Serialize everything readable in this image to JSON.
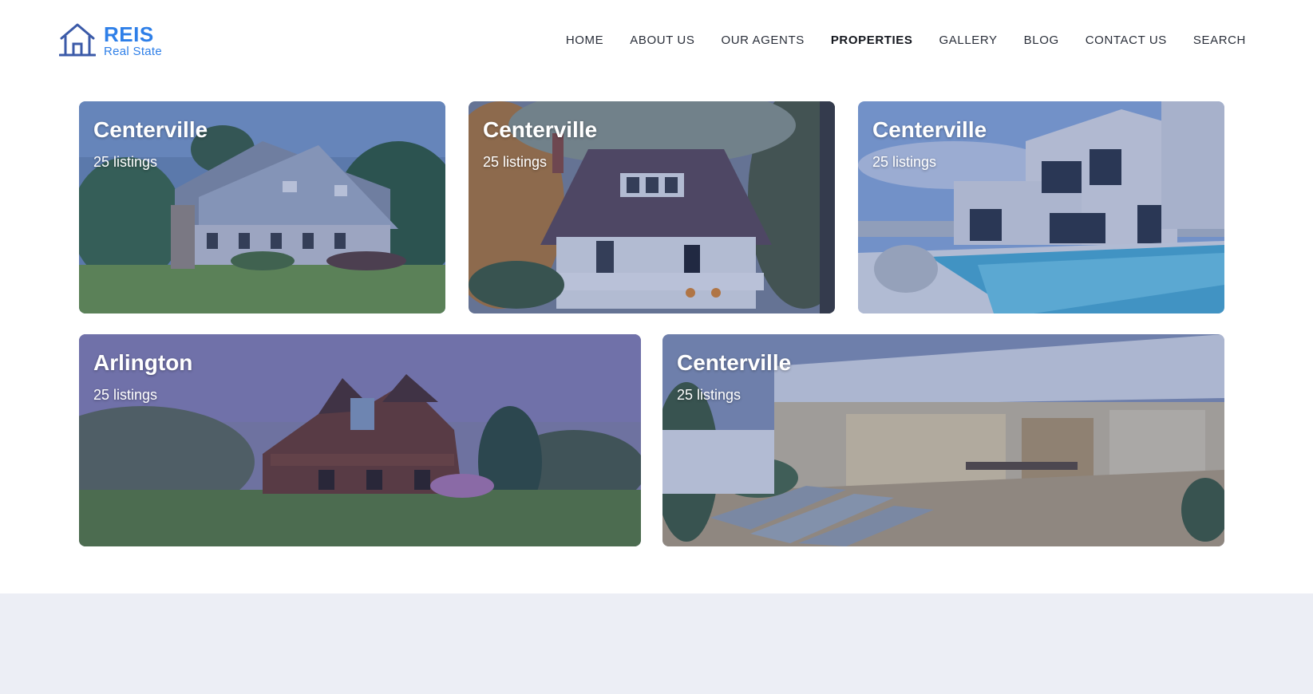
{
  "brand": {
    "title": "REIS",
    "subtitle": "Real State",
    "icon": "house-icon",
    "color": "#2e7fe8"
  },
  "nav": {
    "items": [
      {
        "label": "HOME"
      },
      {
        "label": "ABOUT US"
      },
      {
        "label": "OUR AGENTS"
      },
      {
        "label": "PROPERTIES",
        "active": true
      },
      {
        "label": "GALLERY"
      },
      {
        "label": "BLOG"
      },
      {
        "label": "CONTACT US"
      },
      {
        "label": "SEARCH"
      }
    ]
  },
  "cards": [
    {
      "city": "Centerville",
      "listings": "25 listings",
      "image": "craftsman-house-photo"
    },
    {
      "city": "Centerville",
      "listings": "25 listings",
      "image": "white-cottage-photo"
    },
    {
      "city": "Centerville",
      "listings": "25 listings",
      "image": "modern-villa-pool-photo"
    },
    {
      "city": "Arlington",
      "listings": "25 listings",
      "image": "log-cabin-photo"
    },
    {
      "city": "Centerville",
      "listings": "25 listings",
      "image": "patio-deck-photo"
    }
  ],
  "colors": {
    "overlay": "#28408c",
    "footer_band": "#eceef5"
  }
}
